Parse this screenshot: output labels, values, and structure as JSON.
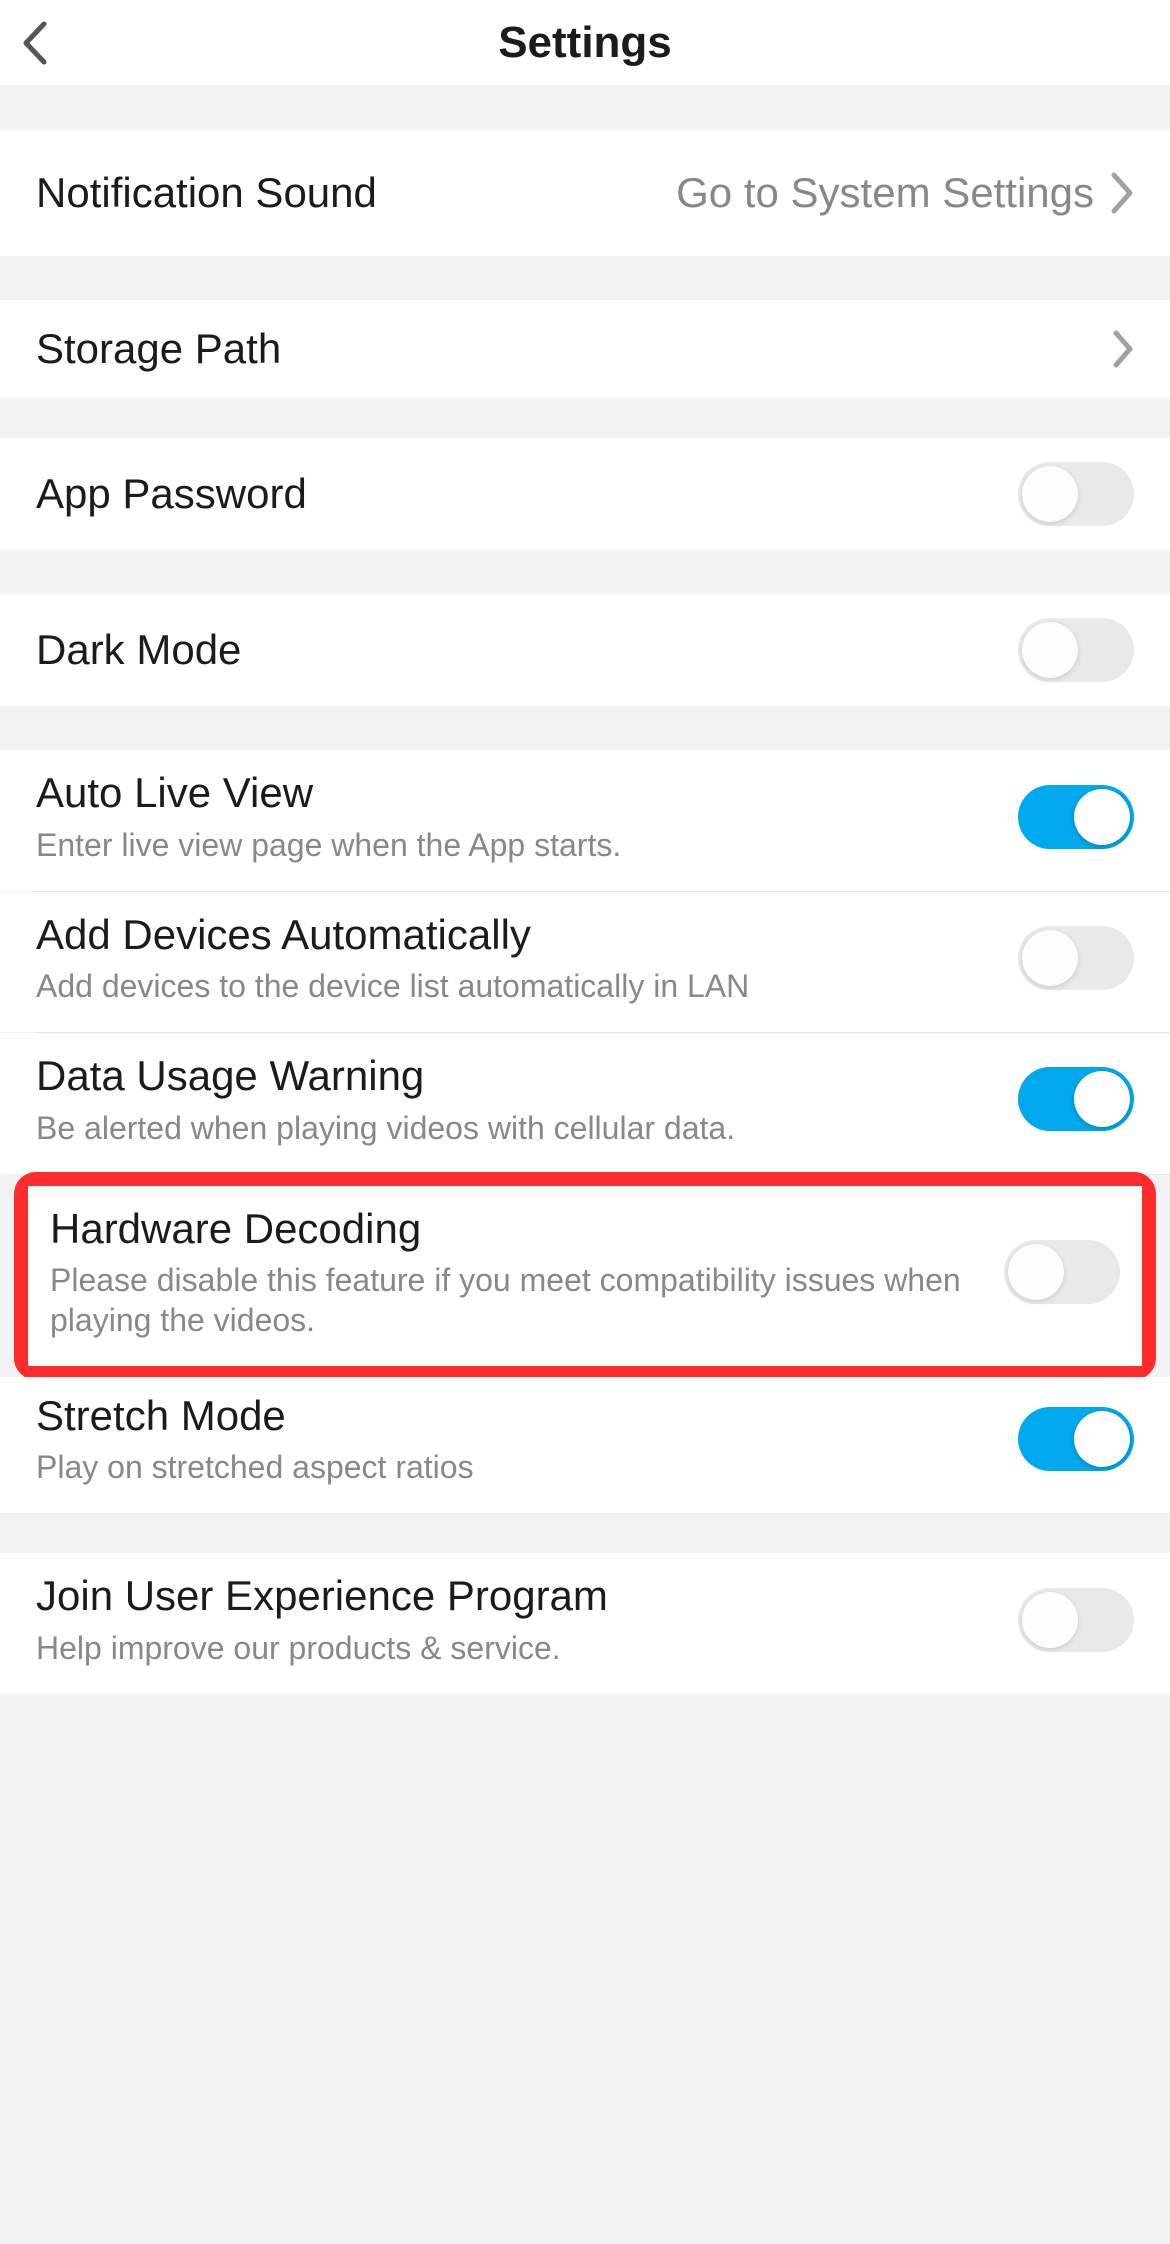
{
  "header": {
    "title": "Settings"
  },
  "rows": {
    "notificationSound": {
      "label": "Notification Sound",
      "value": "Go to System Settings"
    },
    "storagePath": {
      "label": "Storage Path"
    },
    "appPassword": {
      "label": "App Password",
      "on": false
    },
    "darkMode": {
      "label": "Dark Mode",
      "on": false
    },
    "autoLiveView": {
      "label": "Auto Live View",
      "sub": "Enter live view page when the App starts.",
      "on": true
    },
    "addDevices": {
      "label": "Add Devices Automatically",
      "sub": "Add devices to the device list automatically in LAN",
      "on": false
    },
    "dataUsage": {
      "label": "Data Usage Warning",
      "sub": "Be alerted when playing videos with cellular data.",
      "on": true
    },
    "hardwareDecoding": {
      "label": "Hardware Decoding",
      "sub": "Please disable this feature if you meet compatibility issues when playing the videos.",
      "on": false
    },
    "stretchMode": {
      "label": "Stretch Mode",
      "sub": "Play on stretched aspect ratios",
      "on": true
    },
    "joinUEP": {
      "label": "Join User Experience Program",
      "sub": "Help improve our products & service.",
      "on": false
    }
  }
}
